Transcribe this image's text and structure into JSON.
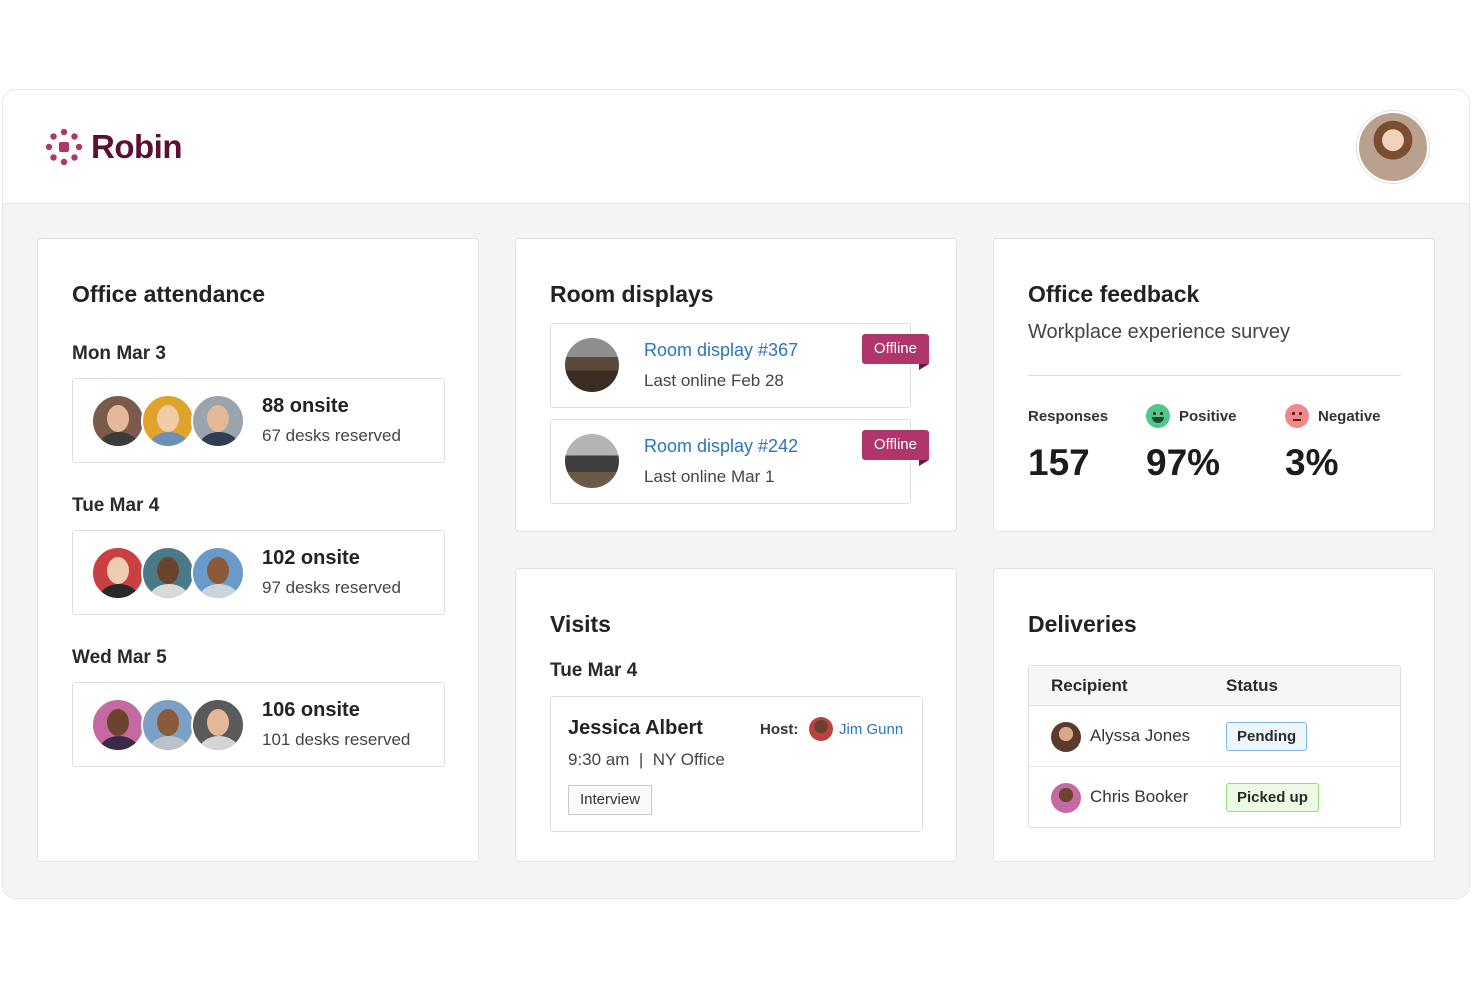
{
  "app": {
    "name": "Robin"
  },
  "attendance": {
    "title": "Office attendance",
    "days": [
      {
        "label": "Mon Mar 3",
        "count": "88 onsite",
        "desks": "67 desks reserved"
      },
      {
        "label": "Tue Mar 4",
        "count": "102 onsite",
        "desks": "97 desks reserved"
      },
      {
        "label": "Wed Mar 5",
        "count": "106 onsite",
        "desks": "101 desks reserved"
      }
    ]
  },
  "room_displays": {
    "title": "Room displays",
    "items": [
      {
        "name": "Room display #367",
        "status": "Last online Feb 28",
        "badge": "Offline"
      },
      {
        "name": "Room display #242",
        "status": "Last online Mar 1",
        "badge": "Offline"
      }
    ]
  },
  "feedback": {
    "title": "Office feedback",
    "subtitle": "Workplace experience survey",
    "stats": [
      {
        "label": "Responses",
        "value": "157"
      },
      {
        "label": "Positive",
        "value": "97%",
        "icon": "smile-icon"
      },
      {
        "label": "Negative",
        "value": "3%",
        "icon": "frown-icon"
      }
    ]
  },
  "visits": {
    "title": "Visits",
    "date": "Tue Mar 4",
    "visitor": "Jessica Albert",
    "time": "9:30 am  |  NY Office",
    "host_label": "Host:",
    "host_name": "Jim Gunn",
    "tag": "Interview"
  },
  "deliveries": {
    "title": "Deliveries",
    "columns": [
      "Recipient",
      "Status"
    ],
    "rows": [
      {
        "recipient": "Alyssa Jones",
        "status": "Pending",
        "status_color": "#7fb6e8"
      },
      {
        "recipient": "Chris Booker",
        "status": "Picked up",
        "status_color": "#94dc7a"
      }
    ]
  },
  "colors": {
    "brand": "#5c0f33",
    "offline": "#b0356c",
    "link": "#2a74c0"
  }
}
